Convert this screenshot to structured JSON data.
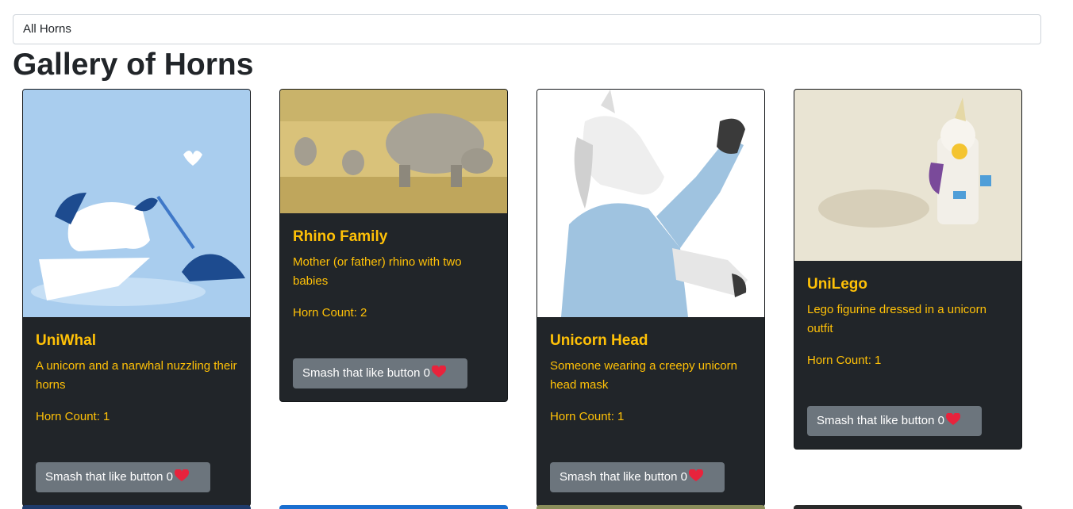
{
  "filter": {
    "selected": "All Horns"
  },
  "page_title": "Gallery of Horns",
  "cards": [
    {
      "title": "UniWhal",
      "description": "A unicorn and a narwhal nuzzling their horns",
      "horns_label": "Horn Count: 1",
      "like_label": "Smash that like button 0"
    },
    {
      "title": "Rhino Family",
      "description": "Mother (or father) rhino with two babies",
      "horns_label": "Horn Count: 2",
      "like_label": "Smash that like button 0"
    },
    {
      "title": "Unicorn Head",
      "description": "Someone wearing a creepy unicorn head mask",
      "horns_label": "Horn Count: 1",
      "like_label": "Smash that like button 0"
    },
    {
      "title": "UniLego",
      "description": "Lego figurine dressed in a unicorn outfit",
      "horns_label": "Horn Count: 1",
      "like_label": "Smash that like button 0"
    }
  ],
  "colors": {
    "card_bg": "#212529",
    "accent": "#ffc107",
    "button": "#6c757d",
    "heart": "#e8233c"
  },
  "icons": {
    "like": "heart-icon"
  }
}
